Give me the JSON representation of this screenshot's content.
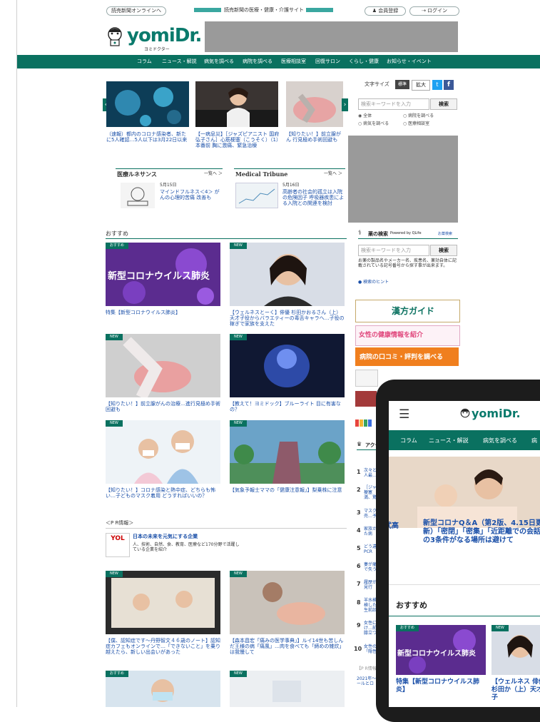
{
  "topbar": {
    "online_label": "読売新聞オンラインへ",
    "site_caption": "読売新聞の医療・健康・介護サイト",
    "member_label": "会員登録",
    "login_label": "ログイン"
  },
  "logo": {
    "text": "yomiDr.",
    "sub": "ヨミドクター"
  },
  "nav": {
    "items": [
      "コラム",
      "ニュース・解説",
      "病気を調べる",
      "病院を調べる",
      "医療相談室",
      "回復サロン",
      "くらし・健康",
      "お知らせ・イベント"
    ]
  },
  "carousel": {
    "items": [
      {
        "caption": "（速報）都内のコロナ感染者、新たに5人確認…5人以下は3月22日以来"
      },
      {
        "caption": "【一病息災】［ジャズピアニスト 国府弘子さん］心筋梗塞（こうそく）（1）本番前 胸に激痛、緊急治療"
      },
      {
        "caption": "【知りたい！】前立腺がん 行見極め手術回避も"
      }
    ]
  },
  "sidebar": {
    "font_size_label": "文字サイズ",
    "font_std": "標準",
    "font_large": "拡大",
    "search_placeholder": "検索キーワードを入力",
    "search_button": "検索",
    "radios": [
      "全体",
      "病院を調べる",
      "病気を調べる",
      "医療相談室"
    ],
    "drug_title": "薬の検索",
    "drug_powered": "Powered by QLife",
    "drug_link": "お薬検索",
    "drug_placeholder": "検索キーワードを入力",
    "drug_button": "検索",
    "drug_desc": "お薬の製品名やメーカー名、疾患名、薬効自体に記載されている記号番号から探す事が出来ます。",
    "drug_hint": "検索のヒント",
    "kampo_label": "漢方ガイド",
    "women_label": "女性の健康情報を紹介",
    "hospital_label": "病院の口コミ・評判を調べる",
    "ranking_title": "アクセス",
    "ranking": [
      "次々と人最…",
      "［ジャ梗塞 満、驚",
      "マスク売…予",
      "家族かた病",
      "どう違PCR",
      "妻が痛で失う",
      "履歴が見行",
      "羊水検検した生前診",
      "女性にけ…前 膝立つ",
      "女性の「隠性"
    ],
    "pr_label": "【P R情報】",
    "pr_item": "2021年〜ールとロ"
  },
  "health_boxes": [
    {
      "title": "医療ルネサンス",
      "more": "一覧へ ＞",
      "date": "5月15日",
      "text": "マインドフルネス＜4＞ がんの心理的苦痛 改善も"
    },
    {
      "title": "Medical Tribune",
      "more": "一覧へ ＞",
      "date": "5月16日",
      "text": "高齢者の社会的孤立は入院の危険因子 呼吸器疾患による入院との関連を検討"
    }
  ],
  "recommend": {
    "title": "おすすめ",
    "cards": [
      {
        "badge": "おすすめ",
        "overlay": "新型コロナウイルス肺炎",
        "caption": "特集【新型コロナウイルス肺炎】"
      },
      {
        "badge": "NEW",
        "caption": "【ウェルネスとーく】俳優 杉田かおるさん（上）天才子役からバラエティーの毒舌キャラへ…子役の稼ぎで家族を支えた"
      },
      {
        "badge": "NEW",
        "caption": "【知りたい！】前立腺がんの治療…進行見極め手術回避も"
      },
      {
        "badge": "NEW",
        "caption": "【教えて！ヨミドック】ブルーライト 目に有害なの？"
      },
      {
        "badge": "NEW",
        "caption": "【知りたい！】コロナ感染と熱中症、どちらも怖い…子どものマスク着用 どうすればいいの？"
      },
      {
        "badge": "NEW",
        "caption": "【気象予報士ママの「健康注意報」】梨乗株に注意"
      }
    ]
  },
  "pr": {
    "header": "＜P R情報＞",
    "logo": "YOL",
    "title": "日本の未来を元気にする企業",
    "desc": "人、技術、自然、食、教育、医療など170分野で活躍している企業を紹介"
  },
  "lower_cards": [
    {
      "badge": "NEW",
      "caption": "【僕、認知症です〜丹野智文４６歳のノート】認知症カフェもオンラインで…「できないこと」を乗り越えたら、新しい出会いがあった"
    },
    {
      "badge": "NEW",
      "caption": "【森本昌宏「痛みの医学事典」】ルイ14世も苦しんだ王様の病「痛風」…肉を食べても「締めの雑炊」は我慢して"
    },
    {
      "badge": "おすすめ"
    },
    {
      "badge": "NEW"
    }
  ],
  "phone": {
    "logo": "yomiDr.",
    "menu_icon": "hamburger-icon",
    "nav": [
      "コラム",
      "ニュース・解説",
      "病気を調べる",
      "病"
    ],
    "left_snip": "式高",
    "article_title": "新型コロナQ＆A（第2版、4.15日更新）「密閉」「密集」「近距離での会話」の3条件がなる場所は避けて",
    "section": "おすすめ",
    "card1_badge": "おすすめ",
    "card1_overlay": "新型コロナウイルス肺炎",
    "card1_caption": "特集【新型コロナウイルス肺炎】",
    "card2_badge": "NEW",
    "card2_caption": "【ウェルネス 俳優 杉田か（上）天才子"
  },
  "colors": {
    "brand": "#0a7160",
    "link": "#1a4fa8",
    "twitter": "#1da1f2",
    "facebook": "#3b5998",
    "orange": "#f07f1e",
    "pink": "#e0457b"
  }
}
